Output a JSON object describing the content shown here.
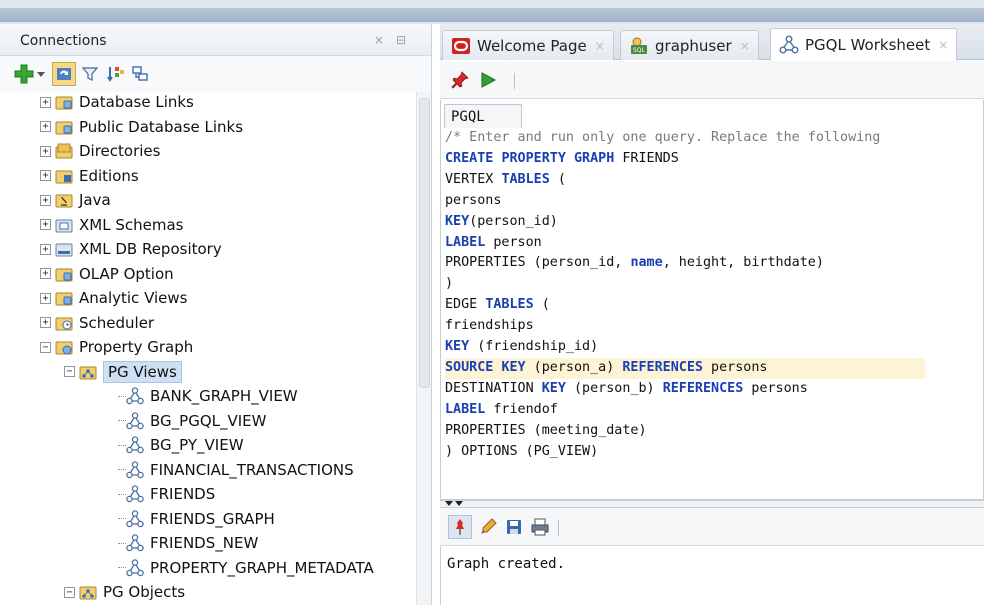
{
  "connections_panel": {
    "title": "Connections",
    "close_glyph": "×",
    "minimize_glyph": "⊟",
    "toolbar_icons": [
      "add-connection-icon",
      "dropdown-arrow-icon",
      "refresh-icon",
      "filter-icon",
      "schema-browser-icon",
      "expand-tree-icon"
    ],
    "tree": [
      {
        "label": "Database Links",
        "expander": "+",
        "icon": "database-links-icon",
        "indent": 0
      },
      {
        "label": "Public Database Links",
        "expander": "+",
        "icon": "public-database-links-icon",
        "indent": 0
      },
      {
        "label": "Directories",
        "expander": "+",
        "icon": "directories-icon",
        "indent": 0
      },
      {
        "label": "Editions",
        "expander": "+",
        "icon": "editions-icon",
        "indent": 0
      },
      {
        "label": "Java",
        "expander": "+",
        "icon": "java-icon",
        "indent": 0
      },
      {
        "label": "XML Schemas",
        "expander": "+",
        "icon": "xml-schemas-icon",
        "indent": 0
      },
      {
        "label": "XML DB Repository",
        "expander": "+",
        "icon": "xml-db-repository-icon",
        "indent": 0
      },
      {
        "label": "OLAP Option",
        "expander": "+",
        "icon": "olap-option-icon",
        "indent": 0
      },
      {
        "label": "Analytic Views",
        "expander": "+",
        "icon": "analytic-views-icon",
        "indent": 0
      },
      {
        "label": "Scheduler",
        "expander": "+",
        "icon": "scheduler-icon",
        "indent": 0
      },
      {
        "label": "Property Graph",
        "expander": "−",
        "icon": "property-graph-icon",
        "indent": 0
      },
      {
        "label": "PG Views",
        "expander": "−",
        "icon": "pg-views-icon",
        "indent": 1,
        "selected": true
      },
      {
        "label": "BANK_GRAPH_VIEW",
        "expander": "",
        "icon": "graph-icon",
        "indent": 2
      },
      {
        "label": "BG_PGQL_VIEW",
        "expander": "",
        "icon": "graph-icon",
        "indent": 2
      },
      {
        "label": "BG_PY_VIEW",
        "expander": "",
        "icon": "graph-icon",
        "indent": 2
      },
      {
        "label": "FINANCIAL_TRANSACTIONS",
        "expander": "",
        "icon": "graph-icon",
        "indent": 2
      },
      {
        "label": "FRIENDS",
        "expander": "",
        "icon": "graph-icon",
        "indent": 2
      },
      {
        "label": "FRIENDS_GRAPH",
        "expander": "",
        "icon": "graph-icon",
        "indent": 2
      },
      {
        "label": "FRIENDS_NEW",
        "expander": "",
        "icon": "graph-icon",
        "indent": 2
      },
      {
        "label": "PROPERTY_GRAPH_METADATA",
        "expander": "",
        "icon": "graph-icon",
        "indent": 2
      },
      {
        "label": "PG Objects",
        "expander": "−",
        "icon": "pg-objects-icon",
        "indent": 1
      }
    ]
  },
  "tabs": [
    {
      "label": "Welcome Page",
      "icon": "oracle-logo-icon",
      "close": "×",
      "active": false
    },
    {
      "label": "graphuser",
      "icon": "sql-connection-icon",
      "close": "×",
      "active": false
    },
    {
      "label": "PGQL Worksheet",
      "icon": "graph-icon",
      "close": "×",
      "active": true
    }
  ],
  "worksheet": {
    "toolbar_icons": [
      "pin-icon",
      "run-icon"
    ],
    "sub_tab_label": "PGQL",
    "code_lines": [
      [
        {
          "t": "/* Enter and run only one query. Replace the following",
          "c": "cm"
        }
      ],
      [
        {
          "t": "CREATE",
          "c": "kw"
        },
        {
          "t": " ",
          "c": ""
        },
        {
          "t": "PROPERTY",
          "c": "kw"
        },
        {
          "t": " ",
          "c": ""
        },
        {
          "t": "GRAPH",
          "c": "kw"
        },
        {
          "t": " FRIENDS",
          "c": ""
        }
      ],
      [
        {
          "t": "VERTEX ",
          "c": ""
        },
        {
          "t": "TABLES",
          "c": "kw"
        },
        {
          "t": " (",
          "c": ""
        }
      ],
      [
        {
          "t": "persons",
          "c": ""
        }
      ],
      [
        {
          "t": "KEY",
          "c": "kw"
        },
        {
          "t": "(person_id)",
          "c": ""
        }
      ],
      [
        {
          "t": "LABEL",
          "c": "kw"
        },
        {
          "t": " person",
          "c": ""
        }
      ],
      [
        {
          "t": "PROPERTIES (person_id, ",
          "c": ""
        },
        {
          "t": "name",
          "c": "kw"
        },
        {
          "t": ", height, birthdate)",
          "c": ""
        }
      ],
      [
        {
          "t": ")",
          "c": ""
        }
      ],
      [
        {
          "t": "EDGE ",
          "c": ""
        },
        {
          "t": "TABLES",
          "c": "kw"
        },
        {
          "t": " (",
          "c": ""
        }
      ],
      [
        {
          "t": "friendships",
          "c": ""
        }
      ],
      [
        {
          "t": "KEY",
          "c": "kw"
        },
        {
          "t": " (friendship_id)",
          "c": ""
        }
      ],
      [
        {
          "t": "SOURCE",
          "c": "kw"
        },
        {
          "t": " ",
          "c": ""
        },
        {
          "t": "KEY",
          "c": "kw"
        },
        {
          "t": " (person_a) ",
          "c": ""
        },
        {
          "t": "REFERENCES",
          "c": "kw"
        },
        {
          "t": " persons",
          "c": ""
        }
      ],
      [
        {
          "t": "DESTINATION ",
          "c": ""
        },
        {
          "t": "KEY",
          "c": "kw"
        },
        {
          "t": " (person_b) ",
          "c": ""
        },
        {
          "t": "REFERENCES",
          "c": "kw"
        },
        {
          "t": " persons",
          "c": ""
        }
      ],
      [
        {
          "t": "LABEL",
          "c": "kw"
        },
        {
          "t": " friendof",
          "c": ""
        }
      ],
      [
        {
          "t": "PROPERTIES (meeting_date)",
          "c": ""
        }
      ],
      [
        {
          "t": ") OPTIONS (PG_VIEW)",
          "c": ""
        }
      ]
    ],
    "highlighted_line": 11
  },
  "log_panel": {
    "toolbar_icons": [
      "pin-icon",
      "clear-icon",
      "save-icon",
      "print-icon"
    ],
    "message": "Graph created."
  },
  "colors": {
    "keyword": "#1a3fb3",
    "comment": "#7a7a7a",
    "selection": "#cfe0f4",
    "current_line": "#fdf4d6"
  }
}
